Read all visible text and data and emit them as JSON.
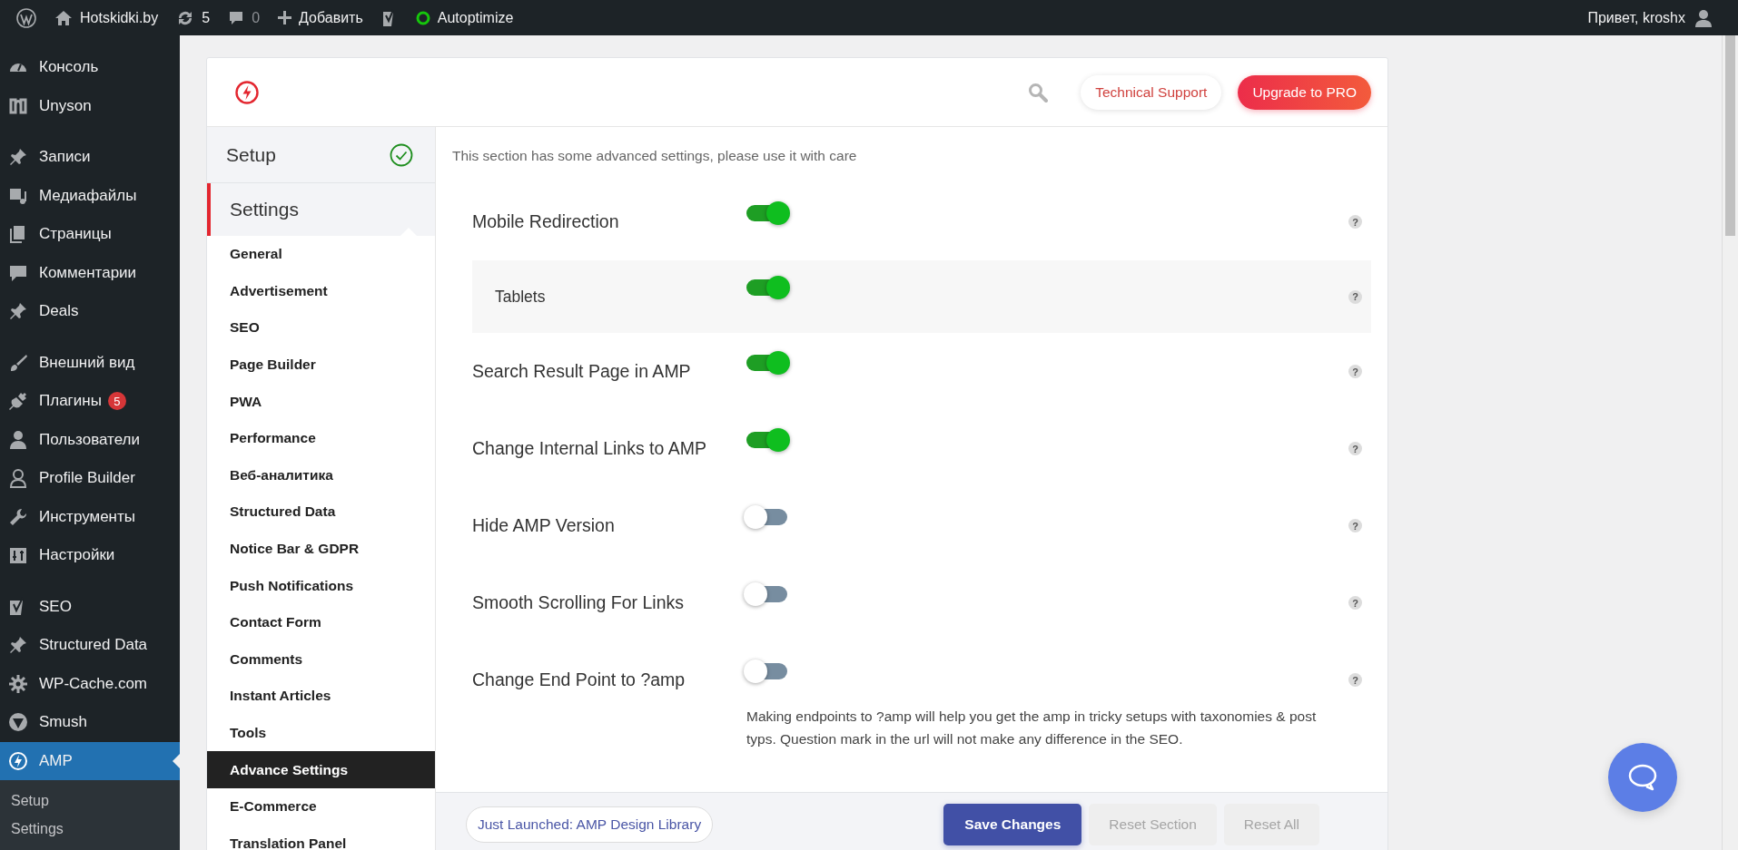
{
  "admin_bar": {
    "items": [
      {
        "kind": "wp-logo"
      },
      {
        "kind": "home",
        "label": "Hotskidki.by"
      },
      {
        "kind": "updates",
        "label": "5"
      },
      {
        "kind": "comments",
        "label": "0"
      },
      {
        "kind": "plus",
        "label": "Добавить"
      },
      {
        "kind": "yoast"
      },
      {
        "kind": "status",
        "label": "Autoptimize"
      }
    ],
    "greeting": "Привет, kroshx"
  },
  "sidebar": {
    "groups": [
      {
        "items": [
          {
            "kind": "dashboard",
            "label": "Консоль",
            "selected": false
          },
          {
            "kind": "unyson",
            "label": "Unyson",
            "selected": false
          }
        ]
      },
      {
        "items": [
          {
            "kind": "pin",
            "label": "Записи",
            "selected": false
          },
          {
            "kind": "media",
            "label": "Медиафайлы",
            "selected": false
          },
          {
            "kind": "pages",
            "label": "Страницы",
            "selected": false
          },
          {
            "kind": "comment",
            "label": "Комментарии",
            "selected": false
          },
          {
            "kind": "pin",
            "label": "Deals",
            "selected": false
          }
        ]
      },
      {
        "items": [
          {
            "kind": "brush",
            "label": "Внешний вид",
            "selected": false
          },
          {
            "kind": "plug",
            "label": "Плагины",
            "badge": "5",
            "selected": false
          },
          {
            "kind": "user",
            "label": "Пользователи",
            "selected": false
          },
          {
            "kind": "user-outline",
            "label": "Profile Builder",
            "selected": false
          },
          {
            "kind": "wrench",
            "label": "Инструменты",
            "selected": false
          },
          {
            "kind": "sliders",
            "label": "Настройки",
            "selected": false
          }
        ]
      },
      {
        "items": [
          {
            "kind": "yoast",
            "label": "SEO",
            "selected": false
          },
          {
            "kind": "pin",
            "label": "Structured Data",
            "selected": false
          },
          {
            "kind": "gear",
            "label": "WP-Cache.com",
            "selected": false
          },
          {
            "kind": "smush",
            "label": "Smush",
            "selected": false
          },
          {
            "kind": "amp",
            "label": "AMP",
            "selected": true,
            "submenu": [
              "Setup",
              "Settings"
            ]
          }
        ]
      }
    ]
  },
  "plugin": {
    "header": {
      "support": "Technical Support",
      "upgrade": "Upgrade to PRO"
    },
    "nav": {
      "setup": {
        "label": "Setup",
        "done": true
      },
      "section": "Settings",
      "items": [
        {
          "label": "General",
          "selected": false
        },
        {
          "label": "Advertisement",
          "selected": false
        },
        {
          "label": "SEO",
          "selected": false
        },
        {
          "label": "Page Builder",
          "selected": false
        },
        {
          "label": "PWA",
          "selected": false
        },
        {
          "label": "Performance",
          "selected": false
        },
        {
          "label": "Веб-аналитика",
          "selected": false
        },
        {
          "label": "Structured Data",
          "selected": false
        },
        {
          "label": "Notice Bar & GDPR",
          "selected": false
        },
        {
          "label": "Push Notifications",
          "selected": false
        },
        {
          "label": "Contact Form",
          "selected": false
        },
        {
          "label": "Comments",
          "selected": false
        },
        {
          "label": "Instant Articles",
          "selected": false
        },
        {
          "label": "Tools",
          "selected": false
        },
        {
          "label": "Advance Settings",
          "selected": true
        },
        {
          "label": "E-Commerce",
          "selected": false
        },
        {
          "label": "Translation Panel",
          "selected": false
        }
      ]
    },
    "intro": "This section has some advanced settings, please use it with care",
    "settings": [
      {
        "label": "Mobile Redirection",
        "on": true,
        "help": "?",
        "children": [
          {
            "label": "Tablets",
            "on": true,
            "help": "?"
          }
        ]
      },
      {
        "label": "Search Result Page in AMP",
        "on": true,
        "help": "?"
      },
      {
        "label": "Change Internal Links to AMP",
        "on": true,
        "help": "?"
      },
      {
        "label": "Hide AMP Version",
        "on": false,
        "help": "?"
      },
      {
        "label": "Smooth Scrolling For Links",
        "on": false,
        "help": "?"
      },
      {
        "label": "Change End Point to ?amp",
        "on": false,
        "help": "?",
        "description": "Making endpoints to ?amp will help you get the amp in tricky setups with taxonomies & post typs. Question mark in the url will not make any difference in the SEO."
      }
    ],
    "footer": {
      "link": "Just Launched: AMP Design Library",
      "buttons": [
        {
          "label": "Save Changes",
          "disabled": false
        },
        {
          "label": "Reset Section",
          "disabled": true
        },
        {
          "label": "Reset All",
          "disabled": true
        }
      ]
    }
  }
}
